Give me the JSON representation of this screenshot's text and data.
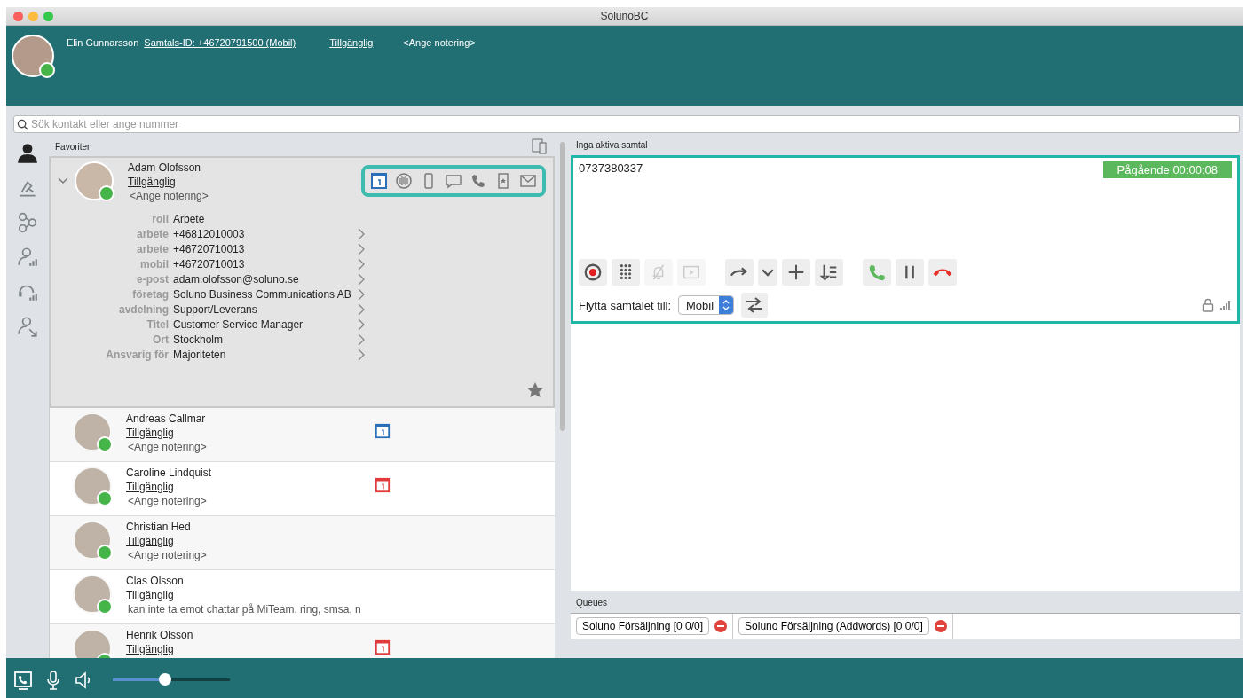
{
  "window": {
    "title": "SolunoBC"
  },
  "user": {
    "name": "Elin Gunnarsson",
    "call_id": "Samtals-ID: +46720791500 (Mobil)",
    "status": "Tillgänglig",
    "note": "<Ange notering>"
  },
  "search": {
    "placeholder": "Sök kontakt eller ange nummer"
  },
  "sidebar": [
    {
      "kind": "person",
      "selected": true
    },
    {
      "kind": "desk",
      "selected": false
    },
    {
      "kind": "nodes",
      "selected": false
    },
    {
      "kind": "person-stats",
      "selected": false
    },
    {
      "kind": "headset-stats",
      "selected": false
    },
    {
      "kind": "person-transfer",
      "selected": false
    }
  ],
  "favorites": {
    "label": "Favoriter",
    "expanded": {
      "name": "Adam Olofsson",
      "status": "Tillgänglig",
      "note": "<Ange notering>",
      "expanded": true,
      "details": [
        {
          "label": "roll",
          "value": "Arbete",
          "kind": "link"
        },
        {
          "label": "arbete",
          "value": "+46812010003",
          "kind": "field"
        },
        {
          "label": "arbete",
          "value": "+46720710013",
          "kind": "field"
        },
        {
          "label": "mobil",
          "value": "+46720710013",
          "kind": "field"
        },
        {
          "label": "e-post",
          "value": "adam.olofsson@soluno.se",
          "kind": "field"
        },
        {
          "label": "företag",
          "value": "Soluno Business Communications AB",
          "kind": "field"
        },
        {
          "label": "avdelning",
          "value": "Support/Leverans",
          "kind": "field"
        },
        {
          "label": "Titel",
          "value": "Customer Service Manager",
          "kind": "field"
        },
        {
          "label": "Ort",
          "value": "Stockholm",
          "kind": "field"
        },
        {
          "label": "Ansvarig för",
          "value": "Majoriteten",
          "kind": "field"
        }
      ]
    },
    "contacts": [
      {
        "name": "Andreas Callmar",
        "status": "Tillgänglig",
        "note": "<Ange notering>",
        "color": "#2a6fb8"
      },
      {
        "name": "Caroline Lindquist",
        "status": "Tillgänglig",
        "note": "<Ange notering>",
        "color": "#e03a3a"
      },
      {
        "name": "Christian Hed",
        "status": "Tillgänglig",
        "note": "<Ange notering>"
      },
      {
        "name": "Clas Olsson",
        "status": "Tillgänglig",
        "note": "kan inte ta emot chattar på MiTeam, ring, smsa, n"
      },
      {
        "name": "Henrik Olsson",
        "status": "Tillgänglig",
        "color": "#e03a3a"
      }
    ]
  },
  "call": {
    "header": "Inga aktiva samtal",
    "number": "0737380337",
    "state": "Pågående 00:00:08",
    "buttons": [
      {
        "kind": "record",
        "disabled": false
      },
      {
        "kind": "dialpad",
        "disabled": false
      },
      {
        "kind": "mute",
        "disabled": true
      },
      {
        "kind": "video",
        "disabled": true
      },
      {
        "kind": "forward",
        "disabled": false
      },
      {
        "kind": "dropdown",
        "disabled": false
      },
      {
        "kind": "add",
        "disabled": false
      },
      {
        "kind": "transfer-list",
        "disabled": false
      },
      {
        "kind": "answer",
        "disabled": false
      },
      {
        "kind": "hold",
        "disabled": false
      },
      {
        "kind": "hangup",
        "disabled": false
      }
    ],
    "move_label": "Flytta samtalet till:",
    "move_target": "Mobil"
  },
  "queues": {
    "label": "Queues",
    "items": [
      {
        "name": "Soluno Försäljning [0 0/0]"
      },
      {
        "name": "Soluno Försäljning (Addwords) [0 0/0]"
      }
    ]
  },
  "volume": {
    "level": 0.45
  }
}
